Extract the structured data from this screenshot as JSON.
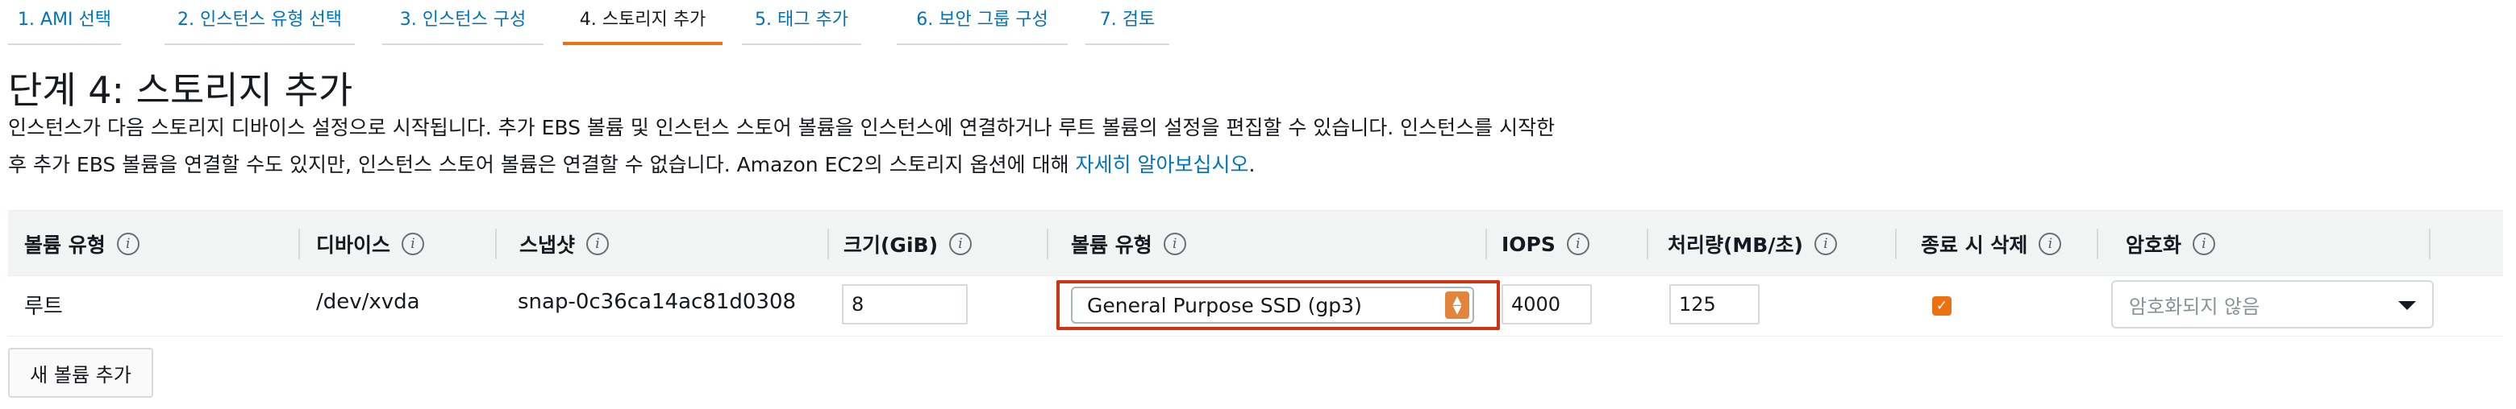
{
  "tabs": [
    {
      "label": "1. AMI 선택"
    },
    {
      "label": "2. 인스턴스 유형 선택"
    },
    {
      "label": "3. 인스턴스 구성"
    },
    {
      "label": "4. 스토리지 추가"
    },
    {
      "label": "5. 태그 추가"
    },
    {
      "label": "6. 보안 그룹 구성"
    },
    {
      "label": "7. 검토"
    }
  ],
  "page": {
    "title": "단계 4: 스토리지 추가",
    "description_line1": "인스턴스가 다음 스토리지 디바이스 설정으로 시작됩니다. 추가 EBS 볼륨 및 인스턴스 스토어 볼륨을 인스턴스에 연결하거나 루트 볼륨의 설정을 편집할 수 있습니다. 인스턴스를 시작한",
    "description_line2": "후 추가 EBS 볼륨을 연결할 수도 있지만, 인스턴스 스토어 볼륨은 연결할 수 없습니다. Amazon EC2의 스토리지 옵션에 대해 ",
    "learn_more_link": "자세히 알아보십시오",
    "description_end": "."
  },
  "table": {
    "headers": {
      "volume_type": "볼륨 유형",
      "device": "디바이스",
      "snapshot": "스냅샷",
      "size": "크기(GiB)",
      "ebs_volume_type": "볼륨 유형",
      "iops": "IOPS",
      "throughput": "처리량(MB/초)",
      "delete_on_termination": "종료 시 삭제",
      "encryption": "암호화"
    },
    "row": {
      "volume_type": "루트",
      "device": "/dev/xvda",
      "snapshot": "snap-0c36ca14ac81d0308",
      "size": "8",
      "ebs_volume_type": "General Purpose SSD (gp3)",
      "iops": "4000",
      "throughput": "125",
      "delete_on_termination": true,
      "encryption_placeholder": "암호화되지 않음"
    }
  },
  "info_icon_glyph": "i",
  "checkbox_glyph": "✓",
  "add_volume_button": "새 볼륨 추가",
  "colors": {
    "link": "#0073bb",
    "active_tab_border": "#ec7211",
    "highlight_border": "#d13212",
    "checkbox": "#ec7211"
  }
}
